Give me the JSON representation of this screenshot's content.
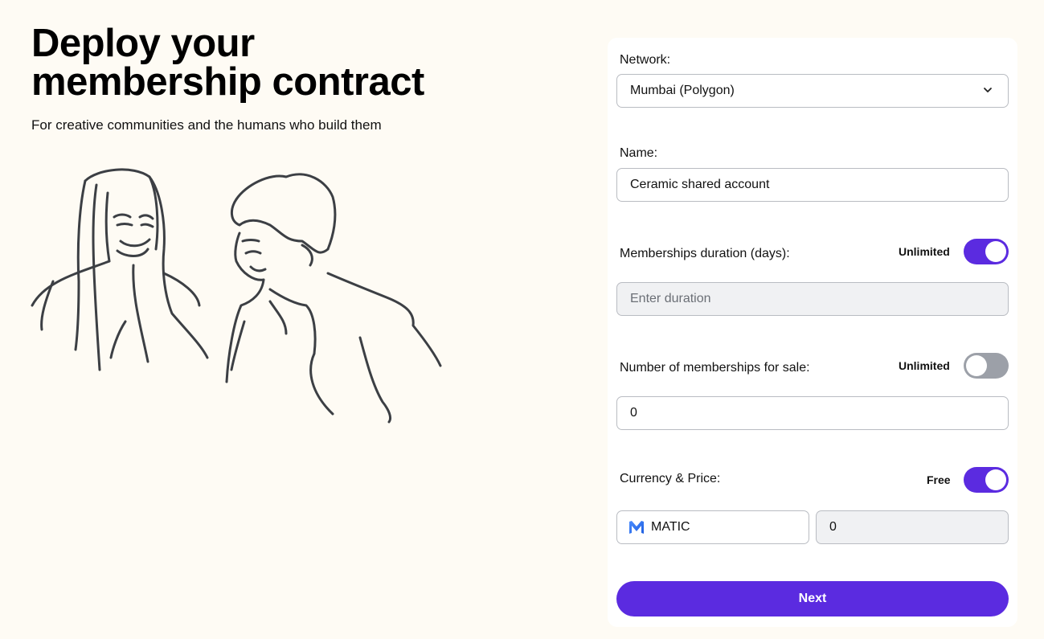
{
  "hero": {
    "title": "Deploy your membership contract",
    "subtitle": "For creative communities and the humans who build them"
  },
  "form": {
    "network": {
      "label": "Network:",
      "value": "Mumbai (Polygon)"
    },
    "name": {
      "label": "Name:",
      "value": "Ceramic shared account"
    },
    "duration": {
      "label": "Memberships duration (days):",
      "toggle_label": "Unlimited",
      "toggle_on": true,
      "placeholder": "Enter duration"
    },
    "quantity": {
      "label": "Number of memberships for sale:",
      "toggle_label": "Unlimited",
      "toggle_on": false,
      "value": "0"
    },
    "price": {
      "label": "Currency & Price:",
      "toggle_label": "Free",
      "toggle_on": true,
      "currency": "MATIC",
      "currency_icon": "matic-icon",
      "value": "0"
    },
    "next_label": "Next"
  },
  "colors": {
    "accent": "#5b2be0",
    "background": "#fefbf4",
    "toggle_off": "#9ca0a8"
  }
}
